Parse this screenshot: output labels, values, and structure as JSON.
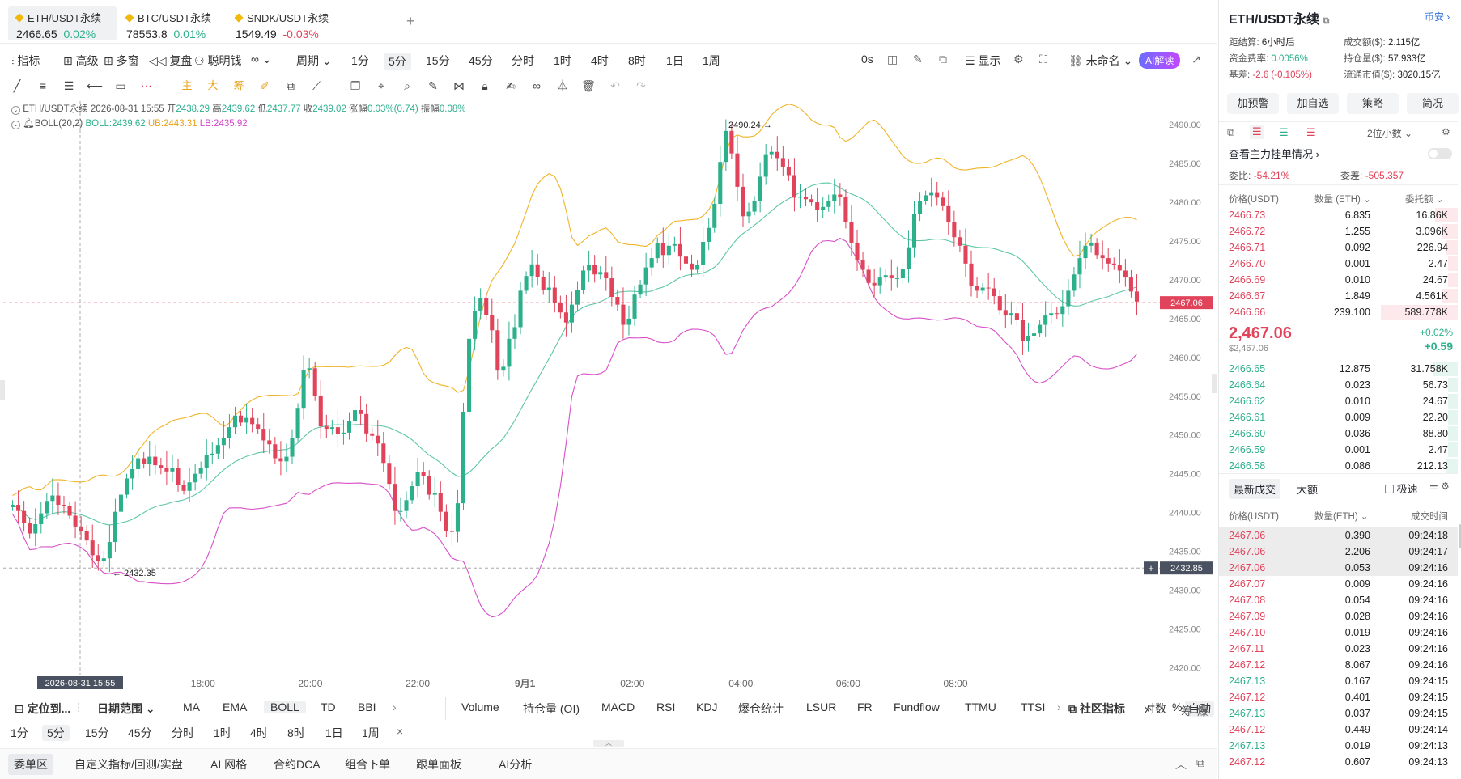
{
  "tabs": [
    {
      "name": "ETH/USDT永续",
      "price": "2466.65",
      "change": "0.02%",
      "active": true
    },
    {
      "name": "BTC/USDT永续",
      "price": "78553.8",
      "change": "0.01%"
    },
    {
      "name": "SNDK/USDT永续",
      "price": "1549.49",
      "change": "-0.03%"
    }
  ],
  "toolbar": {
    "indicators": "指标",
    "advanced": "高级",
    "multi_window": "多窗",
    "replay": "复盘",
    "smart_money": "聪明钱",
    "period": "周期",
    "intervals": [
      "1分",
      "5分",
      "15分",
      "45分",
      "分时",
      "1时",
      "4时",
      "8时",
      "1日",
      "1周"
    ],
    "active_interval": "5分",
    "countdown": "0s",
    "display": "显示",
    "layout_name": "未命名",
    "ai_read": "AI解读"
  },
  "draw_labels": [
    "主",
    "大",
    "筹"
  ],
  "legend": {
    "symbol": "ETH/USDT永续",
    "datetime": "2026-08-31 15:55",
    "open_label": "开",
    "open": "2438.29",
    "high_label": "高",
    "high": "2439.62",
    "low_label": "低",
    "low": "2437.77",
    "close_label": "收",
    "close": "2439.02",
    "change_label": "涨幅",
    "change": "0.03%(0.74)",
    "amp_label": "振幅",
    "amp": "0.08%",
    "boll_name": "BOLL(20,2)",
    "boll_mid": "BOLL:2439.62",
    "boll_ub": "UB:2443.31",
    "boll_lb": "LB:2435.92"
  },
  "chart_data": {
    "type": "candlestick",
    "title": "",
    "y_range": [
      2419,
      2492
    ],
    "y_ticks": [
      "2490.00",
      "2485.00",
      "2480.00",
      "2475.00",
      "2470.00",
      "2465.00",
      "2460.00",
      "2455.00",
      "2450.00",
      "2445.00",
      "2440.00",
      "2435.00",
      "2430.00",
      "2425.00",
      "2420.00"
    ],
    "x_ticks": [
      "18:00",
      "20:00",
      "22:00",
      "9月1",
      "02:00",
      "04:00",
      "06:00",
      "08:00"
    ],
    "crosshair_time": "2026-08-31 15:55",
    "current_price": "2467.06",
    "crosshair_price": "2432.85",
    "high_marker": "2490.24 →",
    "low_marker": "← 2432.35",
    "colors": {
      "up": "#2cb08c",
      "down": "#e0435a",
      "mid": "#5cc6a8",
      "ub": "#f0b429",
      "lb": "#d84fc8"
    },
    "closes": [
      2441.0,
      2440.2,
      2438.6,
      2437.3,
      2438.5,
      2439.9,
      2441.5,
      2442.2,
      2441.0,
      2440.8,
      2439.6,
      2438.2,
      2437.6,
      2436.4,
      2434.5,
      2433.7,
      2434.1,
      2436.2,
      2440.1,
      2442.3,
      2444.4,
      2445.6,
      2447.0,
      2446.3,
      2447.2,
      2446.1,
      2445.7,
      2445.3,
      2445.8,
      2443.6,
      2442.8,
      2443.9,
      2445.0,
      2445.8,
      2447.4,
      2447.6,
      2448.7,
      2449.6,
      2451.0,
      2452.5,
      2451.6,
      2452.2,
      2451.4,
      2450.8,
      2449.3,
      2448.8,
      2447.0,
      2446.6,
      2447.2,
      2449.6,
      2453.5,
      2458.4,
      2458.6,
      2455.0,
      2451.1,
      2450.8,
      2451.0,
      2450.1,
      2450.3,
      2451.8,
      2453.2,
      2452.7,
      2450.2,
      2449.9,
      2448.9,
      2446.4,
      2443.7,
      2440.2,
      2440.2,
      2441.6,
      2443.4,
      2445.2,
      2444.7,
      2442.3,
      2442.5,
      2440.1,
      2437.6,
      2437.5,
      2441.2,
      2453.0,
      2462.4,
      2466.0,
      2467.6,
      2465.5,
      2463.5,
      2458.3,
      2458.8,
      2462.4,
      2463.9,
      2468.6,
      2470.5,
      2472.0,
      2470.4,
      2468.7,
      2469.0,
      2467.0,
      2465.8,
      2464.5,
      2466.8,
      2468.7,
      2471.2,
      2471.9,
      2470.7,
      2471.0,
      2470.2,
      2467.8,
      2466.8,
      2464.2,
      2465.0,
      2468.1,
      2469.4,
      2471.6,
      2472.8,
      2474.7,
      2473.2,
      2474.4,
      2474.6,
      2473.0,
      2472.1,
      2471.3,
      2471.9,
      2474.9,
      2476.7,
      2479.8,
      2485.2,
      2489.2,
      2486.3,
      2482.0,
      2478.2,
      2478.8,
      2480.2,
      2483.3,
      2486.2,
      2486.5,
      2485.7,
      2484.6,
      2483.5,
      2480.6,
      2480.7,
      2480.4,
      2480.0,
      2479.0,
      2479.4,
      2480.2,
      2481.0,
      2480.7,
      2477.4,
      2474.8,
      2472.5,
      2471.3,
      2469.6,
      2469.3,
      2470.3,
      2470.6,
      2470.2,
      2470.2,
      2471.4,
      2474.2,
      2478.5,
      2480.2,
      2480.9,
      2481.3,
      2480.6,
      2479.5,
      2477.4,
      2475.5,
      2474.4,
      2472.1,
      2469.2,
      2468.6,
      2469.0,
      2468.9,
      2467.9,
      2466.1,
      2465.4,
      2465.7,
      2464.8,
      2462.1,
      2462.8,
      2463.1,
      2464.2,
      2465.4,
      2465.7,
      2465.6,
      2466.6,
      2468.6,
      2470.7,
      2472.8,
      2474.4,
      2474.8,
      2473.2,
      2472.8,
      2472.1,
      2471.9,
      2471.2,
      2470.3,
      2468.5,
      2467.2
    ]
  },
  "indicator_bar": {
    "locate": "定位到...",
    "date_range": "日期范围",
    "items": [
      "MA",
      "EMA",
      "BOLL",
      "TD",
      "BBI"
    ],
    "active": "BOLL",
    "sub_items": [
      "Volume",
      "持仓量 (OI)",
      "MACD",
      "RSI",
      "KDJ",
      "爆仓统计",
      "LSUR",
      "FR",
      "Fundflow",
      "TTMU",
      "TTSI"
    ],
    "community": "社区指标",
    "log": "对数",
    "percent": "%",
    "auto": "自动",
    "chips": "筹",
    "explode": "爆"
  },
  "period_bar": {
    "items": [
      "1分",
      "5分",
      "15分",
      "45分",
      "分时",
      "1时",
      "4时",
      "8时",
      "1日",
      "1周"
    ],
    "active": "5分",
    "close": "×"
  },
  "bottom_bar": {
    "items": [
      "委单区",
      "自定义指标/回测/实盘",
      "AI 网格",
      "合约DCA",
      "组合下单",
      "跟单面板",
      "AI分析"
    ],
    "active": "委单区"
  },
  "right_panel": {
    "title": "ETH/USDT永续",
    "exchange": "币安",
    "settle_label": "距结算:",
    "settle": "6小时后",
    "turnover_label": "成交额($):",
    "turnover": "2.115亿",
    "funding_label": "资金费率:",
    "funding": "0.0056%",
    "oi_label": "持仓量($):",
    "oi": "57.933亿",
    "basis_label": "基差:",
    "basis": "-2.6 (-0.105%)",
    "mcap_label": "流通市值($):",
    "mcap": "3020.15亿",
    "buttons": [
      "加预警",
      "加自选",
      "策略",
      "简况"
    ],
    "decimals": "2位小数",
    "main_orders": "查看主力挂单情况",
    "ratio_label": "委比:",
    "ratio": "-54.21%",
    "diff_label": "委差:",
    "diff": "-505.357",
    "ob_headers": [
      "价格(USDT)",
      "数量 (ETH)",
      "委托额"
    ],
    "asks": [
      {
        "price": "2466.73",
        "qty": "6.835",
        "total": "16.86K",
        "fill": 0.28
      },
      {
        "price": "2466.72",
        "qty": "1.255",
        "total": "3.096K",
        "fill": 0.2
      },
      {
        "price": "2466.71",
        "qty": "0.092",
        "total": "226.94",
        "fill": 0.14
      },
      {
        "price": "2466.70",
        "qty": "0.001",
        "total": "2.47",
        "fill": 0.12
      },
      {
        "price": "2466.69",
        "qty": "0.010",
        "total": "24.67",
        "fill": 0.12
      },
      {
        "price": "2466.67",
        "qty": "1.849",
        "total": "4.561K",
        "fill": 0.2
      },
      {
        "price": "2466.66",
        "qty": "239.100",
        "total": "589.778K",
        "fill": 0.95
      }
    ],
    "last_price": "2,467.06",
    "last_usd": "$2,467.06",
    "last_pct": "+0.02%",
    "last_diff": "+0.59",
    "bids": [
      {
        "price": "2466.65",
        "qty": "12.875",
        "total": "31.758K",
        "fill": 0.3
      },
      {
        "price": "2466.64",
        "qty": "0.023",
        "total": "56.73",
        "fill": 0.12
      },
      {
        "price": "2466.62",
        "qty": "0.010",
        "total": "24.67",
        "fill": 0.12
      },
      {
        "price": "2466.61",
        "qty": "0.009",
        "total": "22.20",
        "fill": 0.12
      },
      {
        "price": "2466.60",
        "qty": "0.036",
        "total": "88.80",
        "fill": 0.12
      },
      {
        "price": "2466.59",
        "qty": "0.001",
        "total": "2.47",
        "fill": 0.12
      },
      {
        "price": "2466.58",
        "qty": "0.086",
        "total": "212.13",
        "fill": 0.14
      }
    ],
    "trades_tab": "最新成交",
    "big_tab": "大额",
    "fast": "极速",
    "tr_headers": [
      "价格(USDT)",
      "数量(ETH)",
      "成交时间"
    ],
    "trades": [
      {
        "price": "2467.06",
        "qty": "0.390",
        "time": "09:24:18",
        "side": "sell",
        "hl": true
      },
      {
        "price": "2467.06",
        "qty": "2.206",
        "time": "09:24:17",
        "side": "sell",
        "hl": true
      },
      {
        "price": "2467.06",
        "qty": "0.053",
        "time": "09:24:16",
        "side": "sell",
        "hl": true
      },
      {
        "price": "2467.07",
        "qty": "0.009",
        "time": "09:24:16",
        "side": "sell"
      },
      {
        "price": "2467.08",
        "qty": "0.054",
        "time": "09:24:16",
        "side": "sell"
      },
      {
        "price": "2467.09",
        "qty": "0.028",
        "time": "09:24:16",
        "side": "sell"
      },
      {
        "price": "2467.10",
        "qty": "0.019",
        "time": "09:24:16",
        "side": "sell"
      },
      {
        "price": "2467.11",
        "qty": "0.023",
        "time": "09:24:16",
        "side": "sell"
      },
      {
        "price": "2467.12",
        "qty": "8.067",
        "time": "09:24:16",
        "side": "sell"
      },
      {
        "price": "2467.13",
        "qty": "0.167",
        "time": "09:24:15",
        "side": "buy"
      },
      {
        "price": "2467.12",
        "qty": "0.401",
        "time": "09:24:15",
        "side": "sell"
      },
      {
        "price": "2467.13",
        "qty": "0.037",
        "time": "09:24:15",
        "side": "buy"
      },
      {
        "price": "2467.12",
        "qty": "0.449",
        "time": "09:24:14",
        "side": "sell"
      },
      {
        "price": "2467.13",
        "qty": "0.019",
        "time": "09:24:13",
        "side": "buy"
      },
      {
        "price": "2467.12",
        "qty": "0.607",
        "time": "09:24:13",
        "side": "sell"
      }
    ]
  }
}
